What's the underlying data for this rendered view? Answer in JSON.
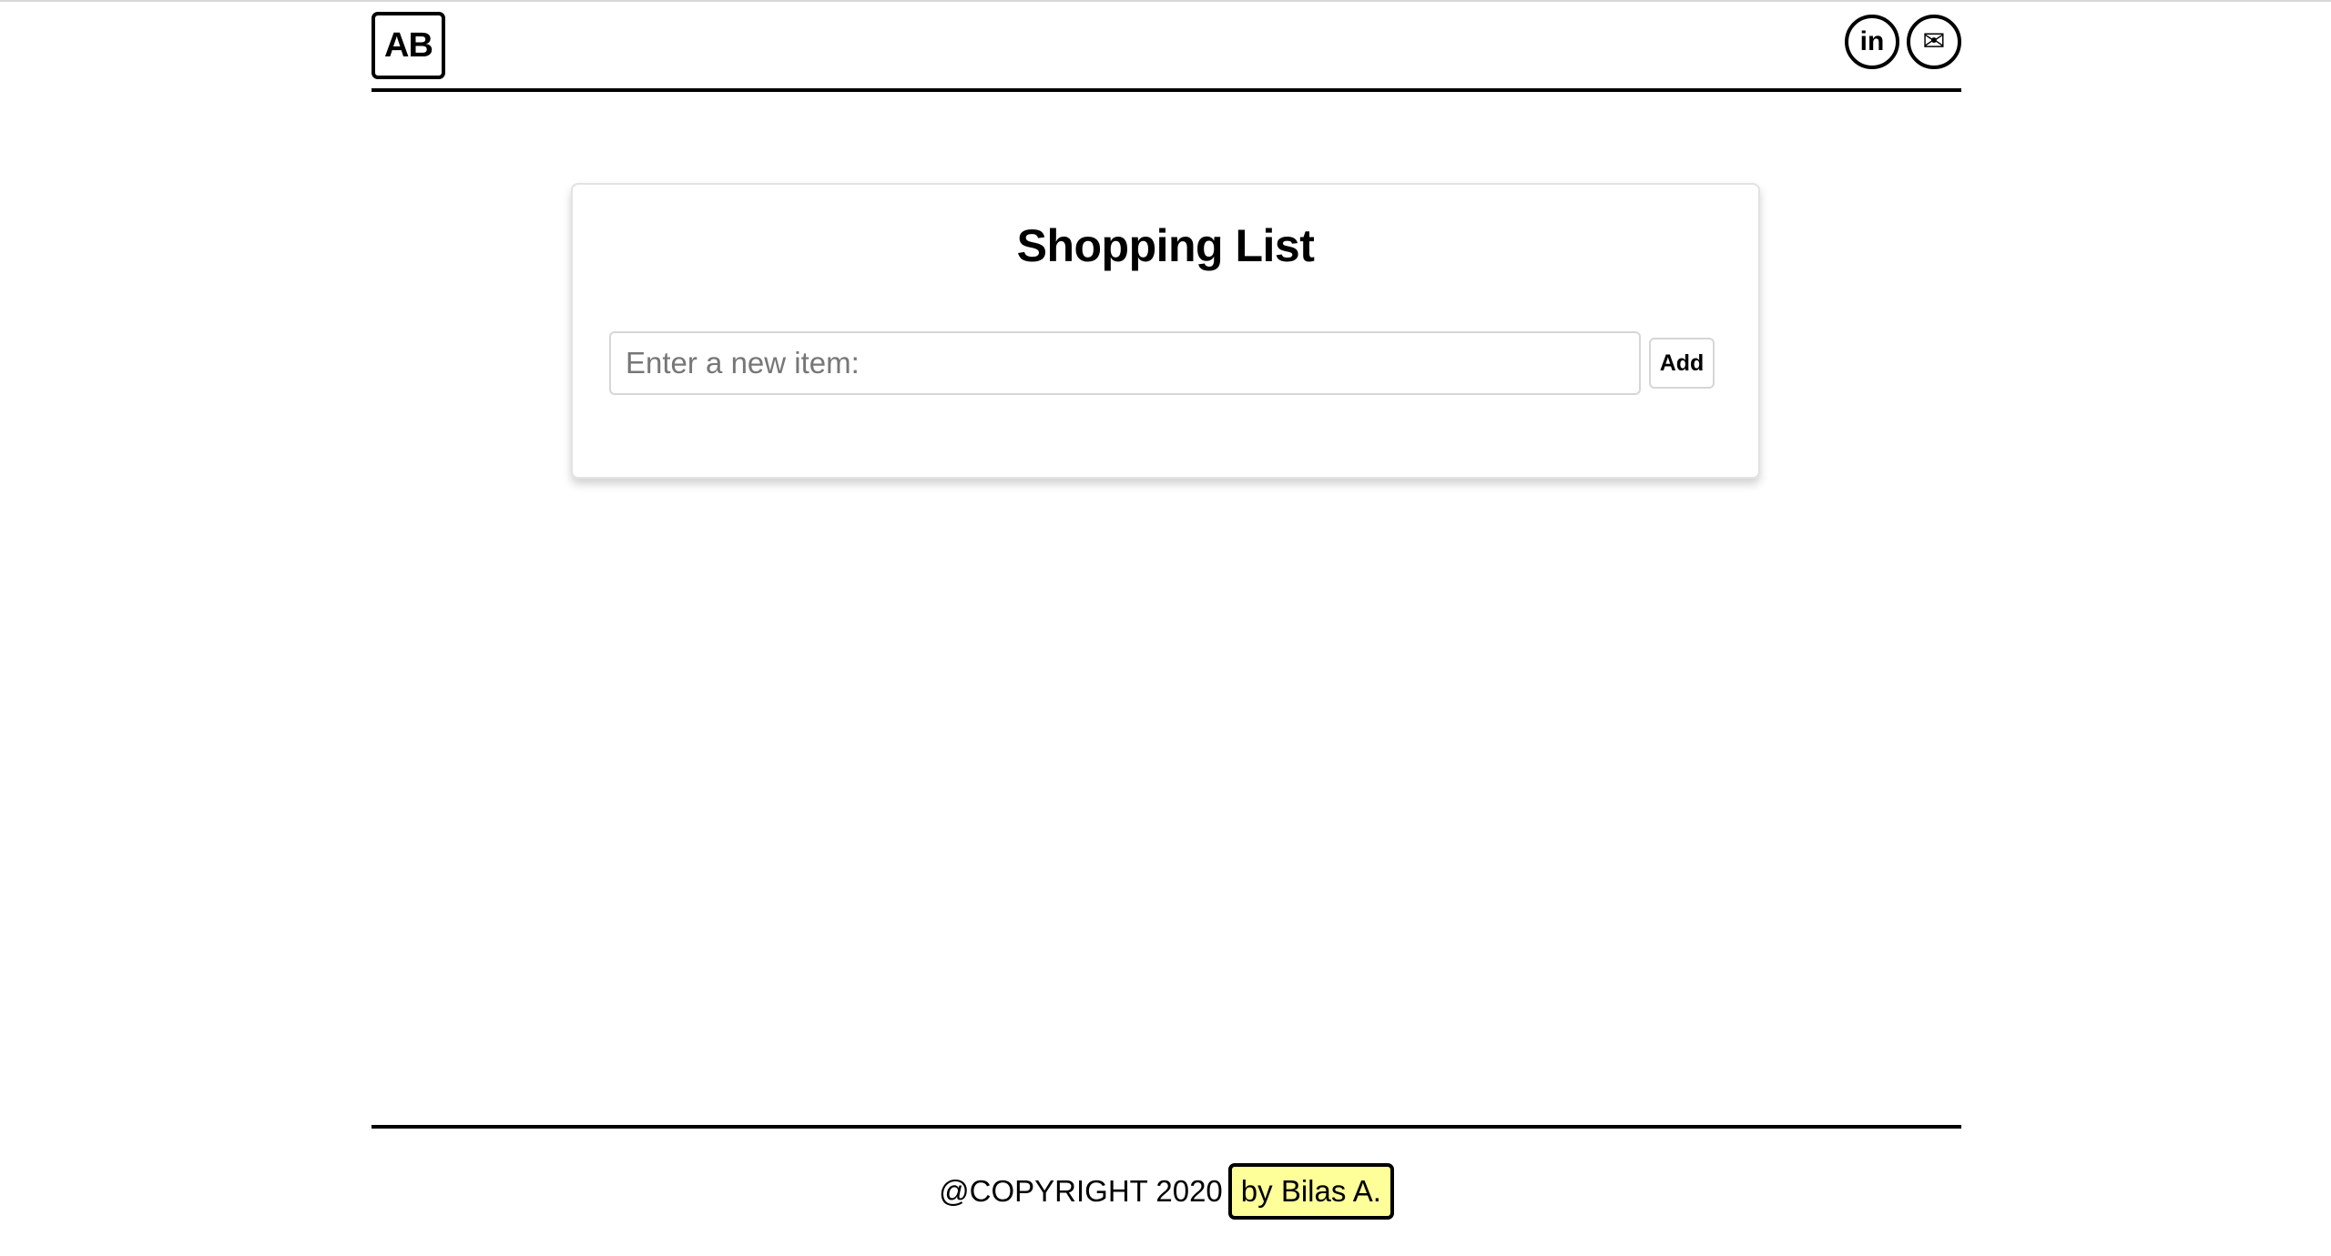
{
  "header": {
    "logo_text": "AB",
    "social": [
      {
        "name": "linkedin",
        "glyph": "in"
      },
      {
        "name": "email",
        "glyph": "✉"
      }
    ]
  },
  "card": {
    "title": "Shopping List",
    "input_placeholder": "Enter a new item:",
    "input_value": "",
    "add_label": "Add"
  },
  "footer": {
    "copyright": "@COPYRIGHT 2020",
    "author": "by Bilas A.",
    "author_highlight": "#ffff99"
  }
}
